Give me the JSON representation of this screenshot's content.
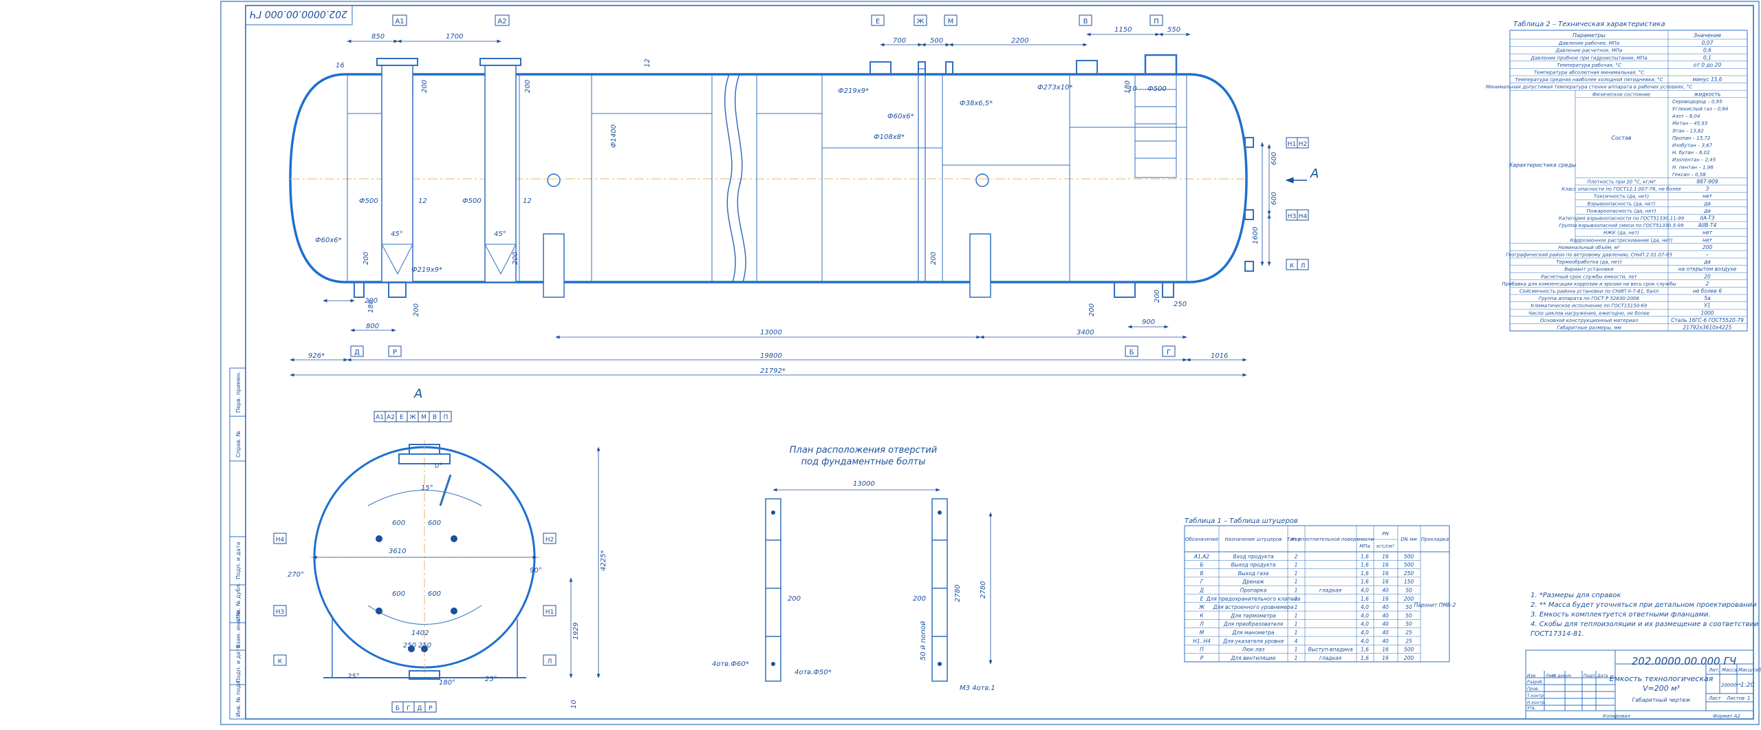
{
  "stamp": "202.0000.00.000 ГЧ",
  "main_view": {
    "markers_top": [
      "А1",
      "А2",
      "Е",
      "Ж",
      "М",
      "В",
      "П"
    ],
    "markers_bottom": [
      "Д",
      "Р",
      "Б",
      "Г"
    ],
    "markers_right": [
      "Н1",
      "Н2",
      "Н3",
      "Н4",
      "К",
      "Л"
    ],
    "arrow_label": "А",
    "dims": {
      "d850": "850",
      "d1700": "1700",
      "d700": "700",
      "d500": "500",
      "d2200": "2200",
      "d1150": "1150",
      "d550": "550",
      "d16": "16",
      "d200a": "200",
      "d200b": "200",
      "d12a": "12",
      "d1400": "Ф1400",
      "p219": "Ф219х9*",
      "p60": "Ф60х6*",
      "p108": "Ф108х8*",
      "p38": "Ф38х6,5*",
      "p273": "Ф273х10*",
      "p500a": "Ф500",
      "p500b": "Ф500",
      "p500c": "Ф500",
      "t12a": "12",
      "t12b": "12",
      "a45a": "45°",
      "a45b": "45°",
      "p60b": "Ф60х6*",
      "p219b": "Ф219х9*",
      "d200c": "200",
      "d200d": "200",
      "d200e": "200",
      "d180a": "180",
      "d200f": "200",
      "d800": "800",
      "d13000": "13000",
      "d3400": "3400",
      "d900": "900",
      "d250": "250",
      "d200g": "200",
      "d926": "926*",
      "d19800": "19800",
      "d1016": "1016",
      "d21792": "21792*",
      "d600a": "600",
      "d600b": "600",
      "d1600": "1600",
      "d200h": "200",
      "d180b": "180",
      "d10": "10"
    }
  },
  "section_view": {
    "title": "А",
    "markers_top": [
      "А1",
      "А2",
      "Е",
      "Ж",
      "М",
      "В",
      "П"
    ],
    "markers_bottom": [
      "Б",
      "Г",
      "Д",
      "Р"
    ],
    "left_markers": [
      "Н4",
      "Н3",
      "К"
    ],
    "right_markers": [
      "Н2",
      "Н1",
      "Л"
    ],
    "dims": {
      "deg0": "0°",
      "deg15": "15°",
      "d600a": "600",
      "d600b": "600",
      "d3610": "3610",
      "deg270": "270°",
      "deg90": "90°",
      "d600c": "600",
      "d600d": "600",
      "d1402": "1402",
      "d250a": "250",
      "d250b": "250",
      "d4225": "4225*",
      "d1929": "1929",
      "deg25a": "25°",
      "deg25b": "25°",
      "deg180": "180°",
      "d10": "10"
    }
  },
  "foundation_plan": {
    "title_line1": "План расположения отверстий",
    "title_line2": "под фундаментные болты",
    "d13000": "13000",
    "d200a": "200",
    "d200b": "200",
    "d2780": "2780",
    "d2780b": "2780",
    "note_holes": "4отв.Ф60*",
    "note_holes2": "4отв.Ф50*",
    "note_bolts": "50 й попой",
    "note_m": "М3 4отв.1"
  },
  "table1": {
    "title": "Таблица 1 – Таблица штуцеров",
    "headers": [
      "Обозначение",
      "Назначение штуцеров",
      "Кол",
      "Тип уплотнительной поверхности",
      "PN",
      "DN мм",
      "Прокладка"
    ],
    "pn_sub": [
      "МПа",
      "кгс/см²"
    ],
    "rows": [
      [
        "А1,А2",
        "Вход продукта",
        "2",
        "",
        "1,6",
        "16",
        "500"
      ],
      [
        "Б",
        "Выход продукта",
        "1",
        "",
        "1,6",
        "16",
        "500"
      ],
      [
        "В",
        "Выход газа",
        "1",
        "",
        "1,6",
        "16",
        "250"
      ],
      [
        "Г",
        "Дренаж",
        "1",
        "",
        "1,6",
        "16",
        "150"
      ],
      [
        "Д",
        "Пропарка",
        "1",
        "гладкая",
        "4,0",
        "40",
        "50"
      ],
      [
        "Е",
        "Для предохранительного клапана",
        "1",
        "",
        "1,6",
        "16",
        "200"
      ],
      [
        "Ж",
        "Для встроенного уровнемера",
        "1",
        "",
        "4,0",
        "40",
        "50"
      ],
      [
        "К",
        "Для термометра",
        "1",
        "",
        "4,0",
        "40",
        "50"
      ],
      [
        "Л",
        "Для преобразователя",
        "1",
        "",
        "4,0",
        "40",
        "50"
      ],
      [
        "М",
        "Для манометра",
        "1",
        "",
        "4,0",
        "40",
        "25"
      ],
      [
        "Н1..Н4",
        "Для указателя уровня",
        "4",
        "",
        "4,0",
        "40",
        "25"
      ],
      [
        "П",
        "Люк-лаз",
        "1",
        "Выступ-впадина",
        "1,6",
        "16",
        "500"
      ],
      [
        "Р",
        "Для вентиляции",
        "1",
        "гладкая",
        "1,6",
        "16",
        "200"
      ]
    ],
    "gasket": "Паронит ПМБ-2"
  },
  "table2": {
    "title": "Таблица 2 – Техническая характеристика",
    "headers": [
      "Параметры",
      "Значение"
    ],
    "rows": [
      [
        "Давление рабочее, МПа",
        "0,07"
      ],
      [
        "Давление расчетное, МПа",
        "0,6"
      ],
      [
        "Давление пробное при гидроиспытании, МПа",
        "0,1"
      ],
      [
        "Температура рабочая, °С",
        "от 0 до 20"
      ],
      [
        "Температура абсолютная минимальная, °С",
        ""
      ],
      [
        "Температура средняя наиболее холодной пятидневки, °С",
        "минус 15,6"
      ],
      [
        "Минимальная допустимая температура стенки аппарата в рабочих условиях, °С",
        ""
      ]
    ],
    "env_label": "Характеристика среды",
    "phys_state": "Физическое состояние",
    "phys_value": "жидкость",
    "composition_label": "Состав",
    "composition": [
      "Сероводород – 0,95",
      "Углекислый газ – 0,84",
      "Азот – 8,04",
      "Метан – 45,93",
      "Этан – 13,82",
      "Пропан – 15,72",
      "Изобутан – 3,67",
      "Н. бутан – 6,02",
      "Изопентан – 2,45",
      "Н. пентан – 1,98",
      "Гексан – 0,58"
    ],
    "env_rows": [
      [
        "Плотность при 20 °С, кг/м³",
        "887-909"
      ],
      [
        "Класс опасности по ГОСТ12.1.007-76, не более",
        "3"
      ],
      [
        "Токсичность (да, нет)",
        "нет"
      ],
      [
        "Взрывоопасность (да, нет)",
        "да"
      ],
      [
        "Пожароопасность (да, нет)",
        "да"
      ],
      [
        "Категория взрывоопасности по ГОСТ51330.11-99",
        "IIA-T3"
      ],
      [
        "Группа взрывоопасной смеси по ГОСТ51330.5-99",
        "АIIВ-Т4"
      ],
      [
        "НЖК (да, нет)",
        "нет"
      ],
      [
        "Коррозионное растрескивание (да, нет)",
        "нет"
      ]
    ],
    "rows_after": [
      [
        "Номинальный объём, м³",
        "200"
      ],
      [
        "Географический район по ветровому давлению, СНиП 2.01.07-85",
        "–"
      ],
      [
        "Термообработка (да, нет)",
        "да"
      ],
      [
        "Вариант установки",
        "на открытом воздухе"
      ],
      [
        "Расчетный срок службы емкости, лет",
        "20"
      ],
      [
        "Прибавка для компенсации коррозии и эрозии на весь срок службы",
        "2"
      ],
      [
        "Сейсмичность района установки по СНИП II-7-81, балл",
        "не более 6"
      ],
      [
        "Группа аппарата по ГОСТ Р 52630-2006",
        "5а"
      ],
      [
        "Климатическое исполнение по ГОСТ15150-69",
        "У1"
      ],
      [
        "Число циклов нагружения, ежегодно, не более",
        "1000"
      ],
      [
        "Основной конструкционный материал",
        "Сталь 16ГС-6 ГОСТ5520-79"
      ],
      [
        "Габаритные размеры, мм",
        "21792х3610х4225"
      ]
    ]
  },
  "notes": [
    "1. *Размеры для справок",
    "2. ** Масса будет уточняться при детальном проектировании",
    "3. Емкость комплектуется ответными фланцами.",
    "4. Скобы для теплоизоляции и их размещение в соответствии с",
    "ГОСТ17314-81."
  ],
  "title_block": {
    "doc_number": "202.0000.00.000 ГЧ",
    "name_line1": "Емкость технологическая",
    "name_line2": "V=200 м³",
    "name_line3": "Габаритный чертеж",
    "lit_label": "Лит.",
    "mass_label": "Масса",
    "scale_label": "Масштаб",
    "mass_value": "20000**",
    "scale_value": "1:20",
    "sheet_label": "Лист",
    "sheets_label": "Листов",
    "sheets_value": "1",
    "roles": [
      "Изм",
      "Лист",
      "№ докум.",
      "Подп.",
      "Дата"
    ],
    "people": [
      "Разраб.",
      "Пров.",
      "Т.контр.",
      "Н.контр.",
      "Утв."
    ],
    "copied": "Копировал",
    "format": "Формат А2"
  },
  "left_strip": [
    "Перв. примен.",
    "Справ. №",
    "Подп. и дата",
    "Инв. № дубл.",
    "Взам. инв. №",
    "Подп. и дата",
    "Инв. № подл."
  ]
}
